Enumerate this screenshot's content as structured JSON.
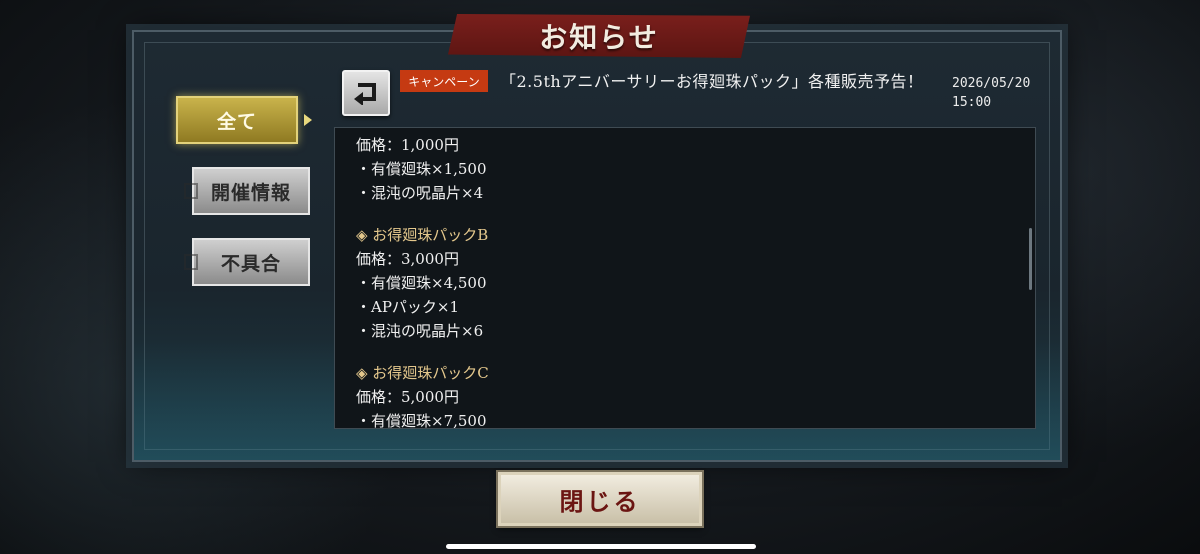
{
  "window": {
    "title": "お知らせ"
  },
  "sidebar": {
    "items": [
      {
        "label": "全て",
        "selected": true
      },
      {
        "label": "開催情報",
        "selected": false
      },
      {
        "label": "不具合",
        "selected": false
      }
    ]
  },
  "notice": {
    "tag": "キャンペーン",
    "title": "「2.5thアニバーサリーお得廻珠パック」各種販売予告！",
    "date": "2026/05/20",
    "time": "15:00"
  },
  "content": {
    "lines_a": [
      "価格：1,000円",
      "・有償廻珠×1,500",
      "・混沌の呪晶片×4"
    ],
    "section_b": "◈ お得廻珠パックB",
    "lines_b": [
      "価格：3,000円",
      "・有償廻珠×4,500",
      "・APパック×1",
      "・混沌の呪晶片×6"
    ],
    "section_c": "◈ お得廻珠パックC",
    "lines_c": [
      "価格：5,000円",
      "・有償廻珠×7,500"
    ]
  },
  "footer": {
    "close_label": "閉じる"
  },
  "colors": {
    "tag_bg": "#c53a12",
    "selected_tab": "#c9b34b",
    "title_banner": "#7a1f1c",
    "section_heading": "#e3c78c"
  },
  "icons": {
    "back": "return-arrow-icon",
    "section_marker": "diamond-icon"
  }
}
